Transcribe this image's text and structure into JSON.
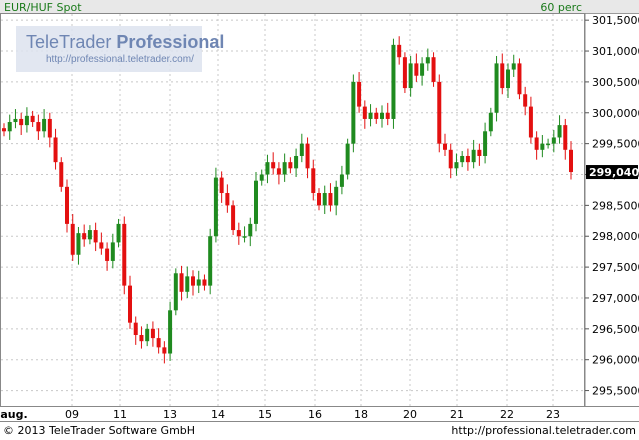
{
  "header": {
    "instrument": "EUR/HUF Spot",
    "interval": "60 perc"
  },
  "watermark": {
    "brand_regular": "TeleTrader ",
    "brand_bold": "Professional",
    "url": "http://professional.teletrader.com/"
  },
  "footer": {
    "copyright": "© 2013 TeleTrader Software GmbH",
    "url": "http://professional.teletrader.com"
  },
  "colors": {
    "up": "#1f8a1f",
    "down": "#e31010",
    "grid": "#c8c8c8",
    "last_price_bg": "#000000",
    "header_bg": "#e8e8e8"
  },
  "chart_data": {
    "type": "candlestick",
    "title": "EUR/HUF Spot",
    "interval": "60 perc",
    "ylim": [
      295.25,
      301.6
    ],
    "y_ticks": [
      "301,5000",
      "301,0000",
      "300,5000",
      "300,0000",
      "299,5000",
      "299,0000",
      "298,5000",
      "298,0000",
      "297,5000",
      "297,0000",
      "296,5000",
      "296,0000",
      "295,5000"
    ],
    "y_tick_values": [
      301.5,
      301.0,
      300.5,
      300.0,
      299.5,
      299.0,
      298.5,
      298.0,
      297.5,
      297.0,
      296.5,
      296.0,
      295.5
    ],
    "last_price": "299,0400",
    "last_price_value": 299.04,
    "x_labels": [
      "aug.",
      "09",
      "11",
      "13",
      "14",
      "15",
      "16",
      "18",
      "20",
      "21",
      "22",
      "23"
    ],
    "series": [
      {
        "name": "EUR/HUF Spot",
        "values": [
          299.7,
          299.85,
          299.9,
          299.8,
          299.95,
          299.85,
          299.7,
          299.9,
          299.6,
          299.2,
          298.8,
          298.2,
          297.7,
          298.05,
          297.95,
          298.1,
          297.9,
          297.8,
          297.6,
          297.9,
          298.2,
          297.2,
          296.6,
          296.4,
          296.3,
          296.5,
          296.35,
          296.2,
          296.1,
          296.8,
          297.4,
          297.1,
          297.35,
          297.2,
          297.3,
          297.2,
          298.0,
          298.95,
          298.7,
          298.5,
          298.1,
          298.0,
          298.0,
          298.2,
          298.9,
          299.0,
          299.2,
          299.1,
          299.0,
          299.2,
          299.1,
          299.3,
          299.5,
          299.1,
          298.7,
          298.5,
          298.7,
          298.5,
          298.8,
          299.0,
          299.5,
          300.5,
          300.1,
          299.9,
          300.0,
          299.9,
          300.0,
          299.9,
          301.1,
          300.9,
          300.4,
          300.8,
          300.6,
          300.8,
          300.9,
          300.5,
          299.5,
          299.4,
          299.1,
          299.2,
          299.3,
          299.2,
          299.4,
          299.3,
          299.7,
          300.0,
          300.8,
          300.4,
          300.7,
          300.8,
          300.3,
          300.1,
          299.6,
          299.4,
          299.5,
          299.5,
          299.6,
          299.8,
          299.4,
          299.04
        ]
      }
    ]
  }
}
